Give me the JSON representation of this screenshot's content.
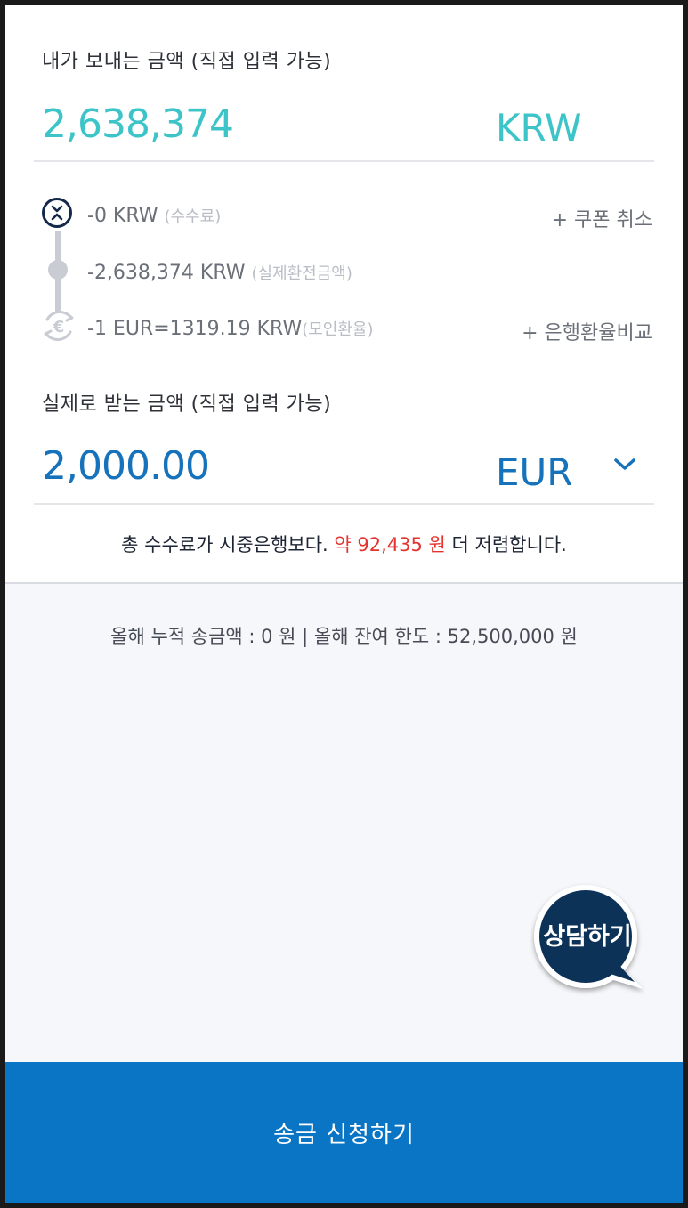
{
  "send": {
    "label": "내가 보내는 금액 (직접 입력 가능)",
    "amount": "2,638,374",
    "currency": "KRW"
  },
  "breakdown": {
    "fee": {
      "amount": "-0 KRW",
      "note": "(수수료)"
    },
    "exchange_amount": {
      "amount": "-2,638,374 KRW",
      "note": "(실제환전금액)"
    },
    "rate": {
      "amount": "-1 EUR=1319.19 KRW",
      "note": "(모인환율)"
    },
    "coupon_action": "+ 쿠폰 취소",
    "compare_action": "+ 은행환율비교"
  },
  "receive": {
    "label": "실제로 받는 금액 (직접 입력 가능)",
    "amount": "2,000.00",
    "currency": "EUR"
  },
  "saving": {
    "prefix": "총 수수료가 시중은행보다. ",
    "highlight": "약 92,435 원",
    "suffix": " 더 저렴합니다."
  },
  "limit_text": "올해 누적 송금액 : 0 원 | 올해 잔여 한도 : 52,500,000 원",
  "chat_label": "상담하기",
  "submit_label": "송금 신청하기",
  "colors": {
    "send_accent": "#3cc4c9",
    "receive_accent": "#1572bb",
    "submit_bg": "#0a75c4",
    "chat_bg": "#0e3058",
    "saving_highlight": "#e3342f"
  },
  "icons": {
    "fee": "swap-icon",
    "rate": "euro-icon",
    "currency_select": "chevron-down-icon",
    "chat": "speech-bubble-icon"
  }
}
